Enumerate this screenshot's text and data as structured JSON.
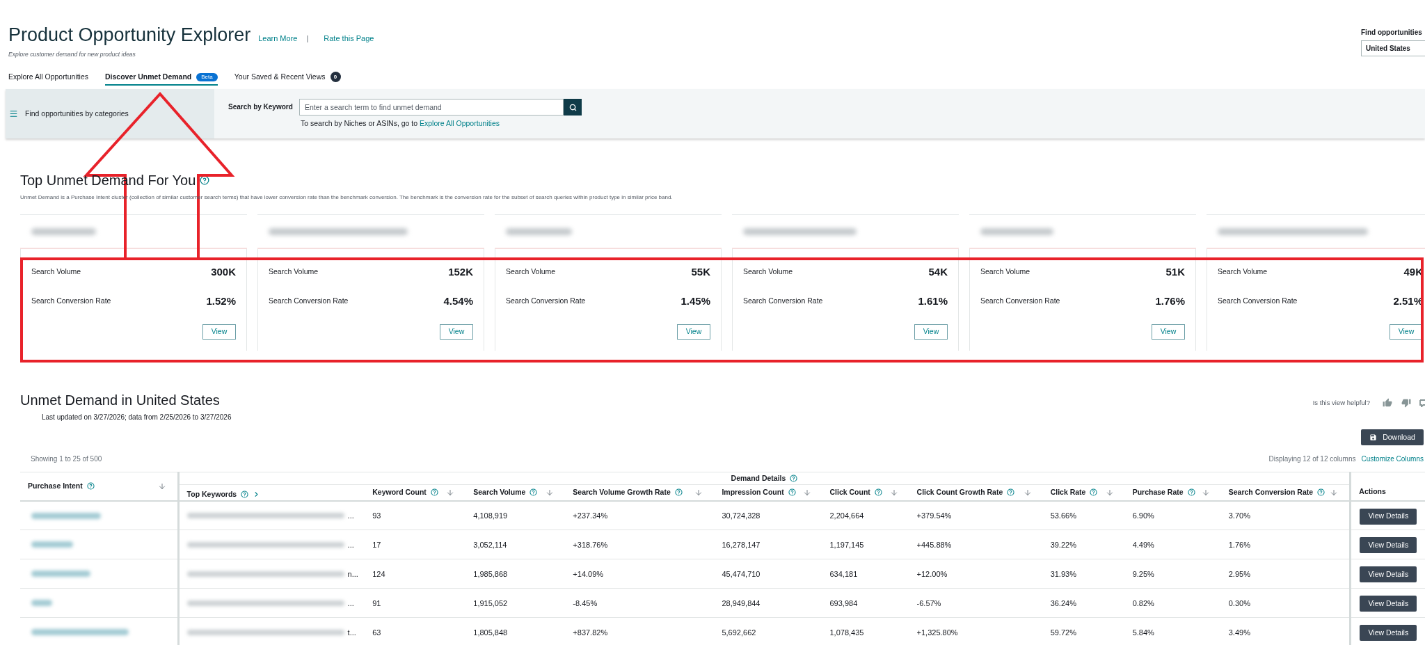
{
  "header": {
    "title": "Product Opportunity Explorer",
    "links": [
      {
        "label": "Learn More"
      },
      {
        "label": "Rate this Page"
      }
    ],
    "separator": "|",
    "subtitle": "Explore customer demand for new product ideas"
  },
  "marketplace": {
    "label": "Find opportunities",
    "value": "United States"
  },
  "tabs": [
    {
      "label": "Explore All Opportunities",
      "selected": false
    },
    {
      "label": "Discover Unmet Demand",
      "selected": true,
      "badge": "Beta"
    },
    {
      "label": "Your Saved & Recent Views",
      "selected": false,
      "count": "0"
    }
  ],
  "search_panel": {
    "categories_button": "Find opportunities by categories",
    "search_label": "Search by Keyword",
    "search_field": {
      "placeholder": "Enter a search term to find unmet demand"
    },
    "hint": "To search by Niches or ASINs, go to",
    "hint_link": "Explore All Opportunities"
  },
  "top_unmet_demand": {
    "title": "Top Unmet Demand For You",
    "description": "Unmet Demand is a Purchase Intent cluster (collection of similar customer search terms) that have lower conversion rate than the benchmark conversion. The benchmark is the conversion rate for the subset of search queries within product type in similar price band.",
    "cards": [
      {
        "metrics": [
          {
            "label": "Search Volume",
            "value": "300K"
          },
          {
            "label": "Search Conversion Rate",
            "value": "1.52%"
          }
        ],
        "button": "View"
      },
      {
        "metrics": [
          {
            "label": "Search Volume",
            "value": "152K"
          },
          {
            "label": "Search Conversion Rate",
            "value": "4.54%"
          }
        ],
        "button": "View"
      },
      {
        "metrics": [
          {
            "label": "Search Volume",
            "value": "55K"
          },
          {
            "label": "Search Conversion Rate",
            "value": "1.45%"
          }
        ],
        "button": "View"
      },
      {
        "metrics": [
          {
            "label": "Search Volume",
            "value": "54K"
          },
          {
            "label": "Search Conversion Rate",
            "value": "1.61%"
          }
        ],
        "button": "View"
      },
      {
        "metrics": [
          {
            "label": "Search Volume",
            "value": "51K"
          },
          {
            "label": "Search Conversion Rate",
            "value": "1.76%"
          }
        ],
        "button": "View"
      },
      {
        "metrics": [
          {
            "label": "Search Volume",
            "value": "49K"
          },
          {
            "label": "Search Conversion Rate",
            "value": "2.51%"
          }
        ],
        "button": "View"
      }
    ]
  },
  "unmet_demand_table": {
    "title": "Unmet Demand in United States",
    "last_updated": "Last updated on 3/27/2026; data from 2/25/2026 to 3/27/2026",
    "feedback": "Is this view helpful?",
    "download_button": "Download",
    "showing": "Showing 1 to 25 of 500",
    "columns_info": "Displaying 12 of 12 columns",
    "customize_link": "Customize Columns",
    "group_header": "Demand Details",
    "columns": [
      {
        "label": "Purchase Intent",
        "kind": "intent"
      },
      {
        "label": "Top Keywords",
        "kind": "keywords"
      },
      {
        "label": "Keyword Count",
        "kind": "metric"
      },
      {
        "label": "Search Volume",
        "kind": "metric"
      },
      {
        "label": "Search Volume Growth Rate",
        "kind": "metric"
      },
      {
        "label": "Impression Count",
        "kind": "metric"
      },
      {
        "label": "Click Count",
        "kind": "metric"
      },
      {
        "label": "Click Count Growth Rate",
        "kind": "metric"
      },
      {
        "label": "Click Rate",
        "kind": "metric"
      },
      {
        "label": "Purchase Rate",
        "kind": "metric"
      },
      {
        "label": "Search Conversion Rate",
        "kind": "metric"
      },
      {
        "label": "Actions",
        "kind": "action"
      }
    ],
    "rows": [
      {
        "keywords_tail": "...",
        "values": [
          "93",
          "4,108,919",
          "+237.34%",
          "30,724,328",
          "2,204,664",
          "+379.54%",
          "53.66%",
          "6.90%",
          "3.70%"
        ],
        "action": "View Details"
      },
      {
        "keywords_tail": "...",
        "values": [
          "17",
          "3,052,114",
          "+318.76%",
          "16,278,147",
          "1,197,145",
          "+445.88%",
          "39.22%",
          "4.49%",
          "1.76%"
        ],
        "action": "View Details"
      },
      {
        "keywords_tail": "n...",
        "values": [
          "124",
          "1,985,868",
          "+14.09%",
          "45,474,710",
          "634,181",
          "+12.00%",
          "31.93%",
          "9.25%",
          "2.95%"
        ],
        "action": "View Details"
      },
      {
        "keywords_tail": "...",
        "values": [
          "91",
          "1,915,052",
          "-8.45%",
          "28,949,844",
          "693,984",
          "-6.57%",
          "36.24%",
          "0.82%",
          "0.30%"
        ],
        "action": "View Details"
      },
      {
        "keywords_tail": "t...",
        "values": [
          "63",
          "1,805,848",
          "+837.82%",
          "5,692,662",
          "1,078,435",
          "+1,325.80%",
          "59.72%",
          "5.84%",
          "3.49%"
        ],
        "action": "View Details"
      }
    ]
  },
  "annotations": {
    "arrow": true,
    "highlight_box": true
  }
}
